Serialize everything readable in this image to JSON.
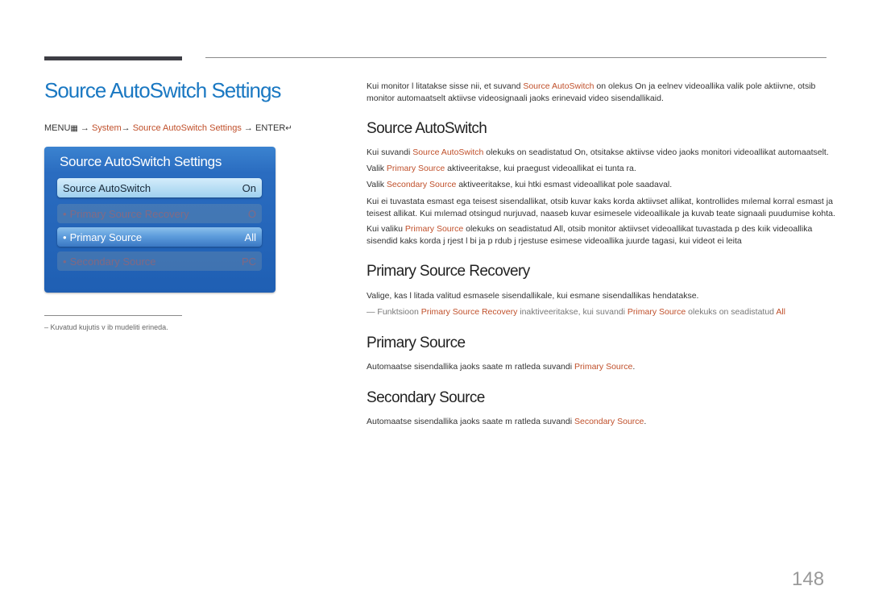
{
  "header": {
    "page_title": "Source AutoSwitch Settings"
  },
  "menu_path": {
    "menu": "MENU",
    "menu_icon": "menu-grid-icon",
    "arrow": "→",
    "system": "System",
    "setting": "Source AutoSwitch Settings",
    "enter": "ENTER",
    "enter_icon": "enter-icon"
  },
  "osd": {
    "title": "Source AutoSwitch Settings",
    "items": [
      {
        "label": "Source AutoSwitch",
        "value": "On",
        "state": "selected"
      },
      {
        "label": "Primary Source Recovery",
        "value": "O",
        "state": "disabled"
      },
      {
        "label": "Primary Source",
        "value": "All",
        "state": "enabled"
      },
      {
        "label": "Secondary Source",
        "value": "PC",
        "state": "disabled"
      }
    ],
    "bullet": "•"
  },
  "footnote": {
    "dash": "–",
    "text": "Kuvatud kujutis v ib mudeliti erineda."
  },
  "intro": {
    "line1_a": "Kui monitor l litatakse sisse nii, et suvand ",
    "line1_hl": "Source AutoSwitch",
    "line1_b": " on olekus On",
    "line1_c": " ja eelnev videoallika valik pole aktiivne, otsib",
    "line2": "monitor automaatselt aktiivse videosignaali jaoks erinevaid video sisendallikaid."
  },
  "sections": {
    "autoswitch": {
      "heading": "Source AutoSwitch",
      "p1_a": "Kui suvandi ",
      "p1_hl": "Source AutoSwitch",
      "p1_b": " olekuks on seadistatud On",
      "p1_c": ", otsitakse aktiivse video jaoks monitori videoallikat automaatselt.",
      "p2_a": "Valik ",
      "p2_hl": "Primary Source",
      "p2_b": " aktiveeritakse, kui praegust videoallikat ei tunta  ra.",
      "p3_a": "Valik ",
      "p3_hl": "Secondary Source",
      "p3_b": " aktiveeritakse, kui  htki esmast videoallikat pole saadaval.",
      "p4_l1": "Kui ei tuvastata esmast ega teisest sisendallikat, otsib kuvar kaks korda aktiivset allikat, kontrollides mılemal korral esmast ja",
      "p4_l2": "teisest allikat. Kui mılemad otsingud nurjuvad, naaseb kuvar esimesele videoallikale ja kuvab teate signaali puudumise kohta.",
      "p5_a": "Kui valiku ",
      "p5_hl": "Primary Source",
      "p5_b": " olekuks on seadistatud All",
      "p5_c": ", otsib monitor aktiivset videoallikat tuvastada p  des kıik videoallika",
      "p5_l2": "sisendid kaks korda j rjest l bi ja p  rdub j rjestuse esimese videoallika juurde tagasi, kui videot ei leita"
    },
    "recovery": {
      "heading": "Primary Source Recovery",
      "p1": "Valige, kas l litada valitud esmasele sisendallikale, kui esmane sisendallikas  hendatakse.",
      "note_dash": "—",
      "note_a": " Funktsioon ",
      "note_hl1": "Primary Source Recovery",
      "note_b": " inaktiveeritakse, kui suvandi ",
      "note_hl2": "Primary Source",
      "note_c": " olekuks on seadistatud ",
      "note_hl3": "All"
    },
    "primary": {
      "heading": "Primary Source",
      "p1_a": "Automaatse sisendallika jaoks saate m  ratleda suvandi ",
      "p1_hl": "Primary Source",
      "p1_b": "."
    },
    "secondary": {
      "heading": "Secondary Source",
      "p1_a": "Automaatse sisendallika jaoks saate m  ratleda suvandi ",
      "p1_hl": "Secondary Source",
      "p1_b": "."
    }
  },
  "page_number": "148",
  "colors": {
    "title_blue": "#1a78c2",
    "highlight": "#c0502b",
    "osd_blue": "#1f5fb3"
  }
}
